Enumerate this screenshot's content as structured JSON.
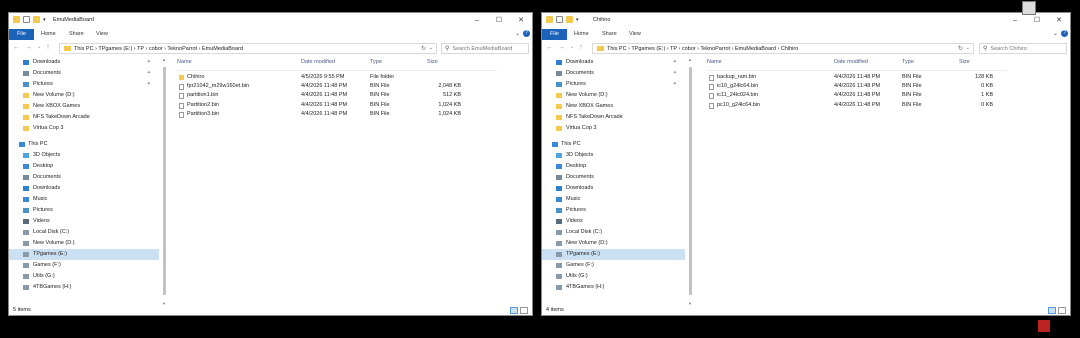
{
  "colors": {
    "accent": "#1a63b8",
    "folder": "#f3c950",
    "selection": "#cce0f3"
  },
  "left_window": {
    "title": "EmuMediaBoard",
    "tabs": {
      "file": "File",
      "home": "Home",
      "share": "Share",
      "view": "View"
    },
    "breadcrumb": "This PC  ›  TPgames (E:)  ›  TP  ›  cobor  ›  TeknoParrot  ›  EmuMediaBoard",
    "search_placeholder": "Search EmuMediaBoard",
    "columns": {
      "name": "Name",
      "date": "Date modified",
      "type": "Type",
      "size": "Size"
    },
    "files": [
      {
        "name": "Chihiro",
        "date": "4/5/2026 9:55 PM",
        "type": "File folder",
        "size": "",
        "kind": "folder"
      },
      {
        "name": "fpr21042_m29w160et.bin",
        "date": "4/4/2026 11:48 PM",
        "type": "BIN File",
        "size": "2,048 KB",
        "kind": "file"
      },
      {
        "name": "partition1.bin",
        "date": "4/4/2026 11:48 PM",
        "type": "BIN File",
        "size": "512 KB",
        "kind": "file"
      },
      {
        "name": "Partition2.bin",
        "date": "4/4/2026 11:48 PM",
        "type": "BIN File",
        "size": "1,024 KB",
        "kind": "file"
      },
      {
        "name": "Partition3.bin",
        "date": "4/4/2026 11:48 PM",
        "type": "BIN File",
        "size": "1,024 KB",
        "kind": "file"
      }
    ],
    "status": "5 items"
  },
  "right_window": {
    "title": "Chihiro",
    "tabs": {
      "file": "File",
      "home": "Home",
      "share": "Share",
      "view": "View"
    },
    "breadcrumb": "This PC  ›  TPgames (E:)  ›  TP  ›  cobor  ›  TeknoParrot  ›  EmuMediaBoard  ›  Chihiro",
    "search_placeholder": "Search Chihiro",
    "columns": {
      "name": "Name",
      "date": "Date modified",
      "type": "Type",
      "size": "Size"
    },
    "files": [
      {
        "name": "backup_ram.bin",
        "date": "4/4/2026 11:48 PM",
        "type": "BIN File",
        "size": "128 KB",
        "kind": "file"
      },
      {
        "name": "ic10_g24lc64.bin",
        "date": "4/4/2026 11:48 PM",
        "type": "BIN File",
        "size": "0 KB",
        "kind": "file"
      },
      {
        "name": "ic11_24lc024.bin",
        "date": "4/4/2026 11:48 PM",
        "type": "BIN File",
        "size": "1 KB",
        "kind": "file"
      },
      {
        "name": "pc10_g24lc64.bin",
        "date": "4/4/2026 11:48 PM",
        "type": "BIN File",
        "size": "0 KB",
        "kind": "file"
      }
    ],
    "status": "4 items"
  },
  "sidebar": [
    {
      "label": "Downloads",
      "icon": "download-icon",
      "pinned": true
    },
    {
      "label": "Documents",
      "icon": "documents-icon",
      "pinned": true
    },
    {
      "label": "Pictures",
      "icon": "pictures-icon",
      "pinned": true
    },
    {
      "label": "New Volume (D:)",
      "icon": "folder-icon",
      "pinned": false
    },
    {
      "label": "New XBOX Games",
      "icon": "folder-icon",
      "pinned": false
    },
    {
      "label": "NFS TakeDown Arcade",
      "icon": "folder-icon",
      "pinned": false
    },
    {
      "label": "Virtua Cop 3",
      "icon": "folder-icon",
      "pinned": false
    },
    {
      "label": "This PC",
      "icon": "pc-icon",
      "pinned": false
    },
    {
      "label": "3D Objects",
      "icon": "3d-objects-icon",
      "pinned": false
    },
    {
      "label": "Desktop",
      "icon": "desktop-icon",
      "pinned": false
    },
    {
      "label": "Documents",
      "icon": "documents-icon",
      "pinned": false
    },
    {
      "label": "Downloads",
      "icon": "download-icon",
      "pinned": false
    },
    {
      "label": "Music",
      "icon": "music-icon",
      "pinned": false
    },
    {
      "label": "Pictures",
      "icon": "pictures-icon",
      "pinned": false
    },
    {
      "label": "Videos",
      "icon": "videos-icon",
      "pinned": false
    },
    {
      "label": "Local Disk (C:)",
      "icon": "drive-icon",
      "pinned": false
    },
    {
      "label": "New Volume (D:)",
      "icon": "drive-icon",
      "pinned": false
    },
    {
      "label": "TPgames (E:)",
      "icon": "drive-icon",
      "pinned": false,
      "selected": true
    },
    {
      "label": "Games (F:)",
      "icon": "drive-icon",
      "pinned": false
    },
    {
      "label": "Utils (G:)",
      "icon": "drive-icon",
      "pinned": false
    },
    {
      "label": "4TBGames (H:)",
      "icon": "drive-icon",
      "pinned": false
    }
  ]
}
